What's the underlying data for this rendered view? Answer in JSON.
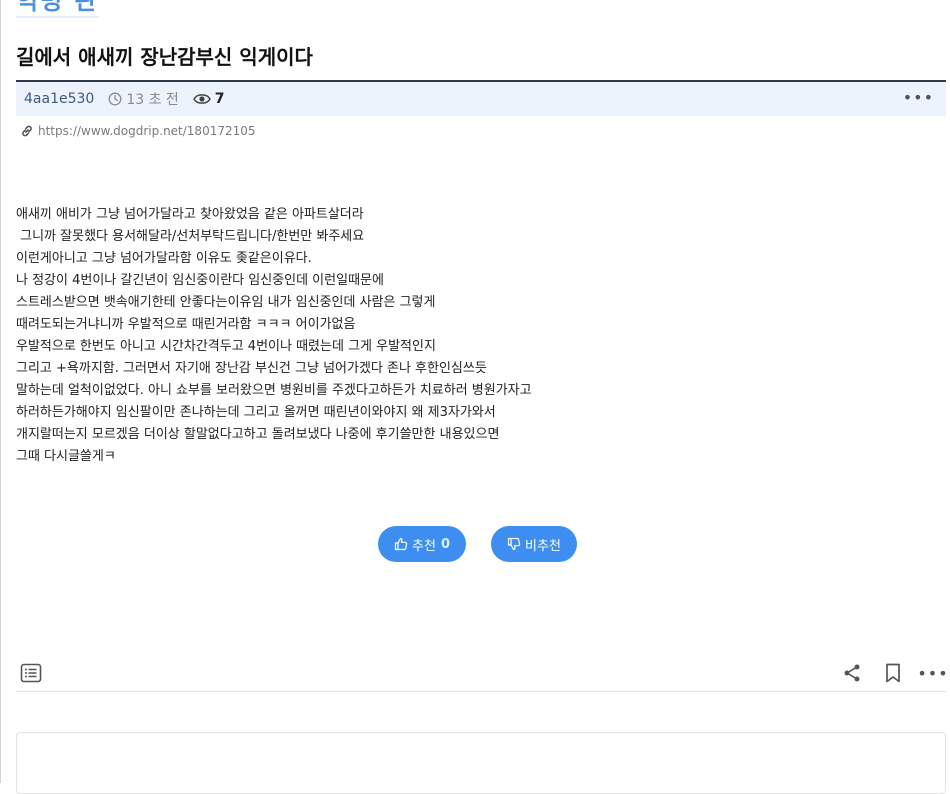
{
  "board": {
    "title": "익명 판"
  },
  "post": {
    "title": "길에서 애새끼 장난감부신 익게이다",
    "author": "4aa1e530",
    "time": "13 초 전",
    "views": "7",
    "more_label": "•••",
    "url": "https://www.dogdrip.net/180172105",
    "lines": [
      "애새끼 애비가 그냥 넘어가달라고 찾아왔었음 같은 아파트살더라",
      " 그니까 잘못했다 용서해달라/선처부탁드립니다/한번만 봐주세요",
      "이런게아니고 그냥 넘어가달라함 이유도 좆같은이유다.",
      "나 정강이 4번이나 갈긴년이 임신중이란다 임신중인데 이런일때문에",
      "스트레스받으면 뱃속애기한테 안좋다는이유임 내가 임신중인데 사람은 그렇게",
      "때려도되는거냐니까 우발적으로 때린거라함 ㅋㅋㅋ 어이가없음",
      "우발적으로 한번도 아니고 시간차간격두고 4번이나 때렸는데 그게 우발적인지",
      "그리고 +욕까지함. 그러면서 자기애 장난감 부신건 그냥 넘어가겠다 존나 후한인심쓰듯",
      "말하는데 얼척이없었다. 아니 쇼부를 보러왔으면 병원비를 주겠다고하든가 치료하러 병원가자고",
      "하러하든가해야지 임신팔이만 존나하는데 그리고 올꺼면 때린년이와야지 왜 제3자가와서",
      "개지랄떠는지 모르겠음 더이상 할말없다고하고 돌려보냈다 나중에 후기쓸만한 내용있으면",
      "그때 다시글쓸게ㅋ"
    ]
  },
  "votes": {
    "up_label": "추천",
    "up_count": "0",
    "down_label": "비추천"
  },
  "bottom": {
    "more_label": "•••"
  },
  "icons": {
    "clock": "clock-icon",
    "eye": "eye-icon",
    "link": "link-icon",
    "thumbs_up": "thumbs-up-icon",
    "thumbs_down": "thumbs-down-icon",
    "list": "list-icon",
    "share": "share-icon",
    "bookmark": "bookmark-icon"
  },
  "colors": {
    "accent": "#3d8ef0",
    "meta_bg": "#edf3fd",
    "title_rule": "#2f3a4a",
    "board_title": "#4a90e2"
  }
}
